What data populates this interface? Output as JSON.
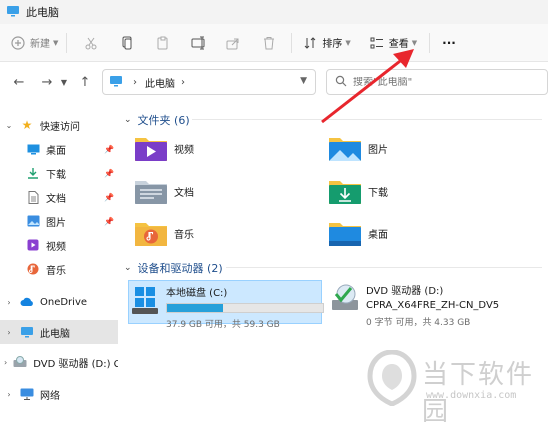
{
  "window": {
    "title": "此电脑"
  },
  "toolbar": {
    "new_label": "新建",
    "sort_label": "排序",
    "view_label": "查看",
    "more_label": "···"
  },
  "nav": {
    "address_location": "此电脑",
    "search_placeholder": "搜索\"此电脑\""
  },
  "sidebar": {
    "quick_access": "快速访问",
    "items": [
      {
        "label": "桌面",
        "icon": "desktop-icon"
      },
      {
        "label": "下载",
        "icon": "download-icon"
      },
      {
        "label": "文档",
        "icon": "document-icon"
      },
      {
        "label": "图片",
        "icon": "picture-icon"
      },
      {
        "label": "视频",
        "icon": "video-icon"
      },
      {
        "label": "音乐",
        "icon": "music-icon"
      }
    ],
    "onedrive": "OneDrive",
    "this_pc": "此电脑",
    "dvd": "DVD 驱动器 (D:) CI",
    "network": "网络"
  },
  "content": {
    "folders_header": "文件夹 (6)",
    "folders": [
      {
        "name": "视频",
        "icon": "video-folder-icon"
      },
      {
        "name": "图片",
        "icon": "picture-folder-icon"
      },
      {
        "name": "文档",
        "icon": "document-folder-icon"
      },
      {
        "name": "下载",
        "icon": "download-folder-icon"
      },
      {
        "name": "音乐",
        "icon": "music-folder-icon"
      },
      {
        "name": "桌面",
        "icon": "desktop-folder-icon"
      }
    ],
    "drives_header": "设备和驱动器 (2)",
    "drives": [
      {
        "name": "本地磁盘 (C:)",
        "detail": "37.9 GB 可用，共 59.3 GB",
        "used_fraction": 0.36
      },
      {
        "name": "DVD 驱动器 (D:)",
        "label": "CPRA_X64FRE_ZH-CN_DV5",
        "detail": "0 字节 可用，共 4.33 GB"
      }
    ]
  },
  "watermark": {
    "name": "当下软件园",
    "url": "www.downxia.com"
  },
  "colors": {
    "accent": "#0067c0",
    "selection": "#cce8ff",
    "annotation": "#e8262d"
  }
}
